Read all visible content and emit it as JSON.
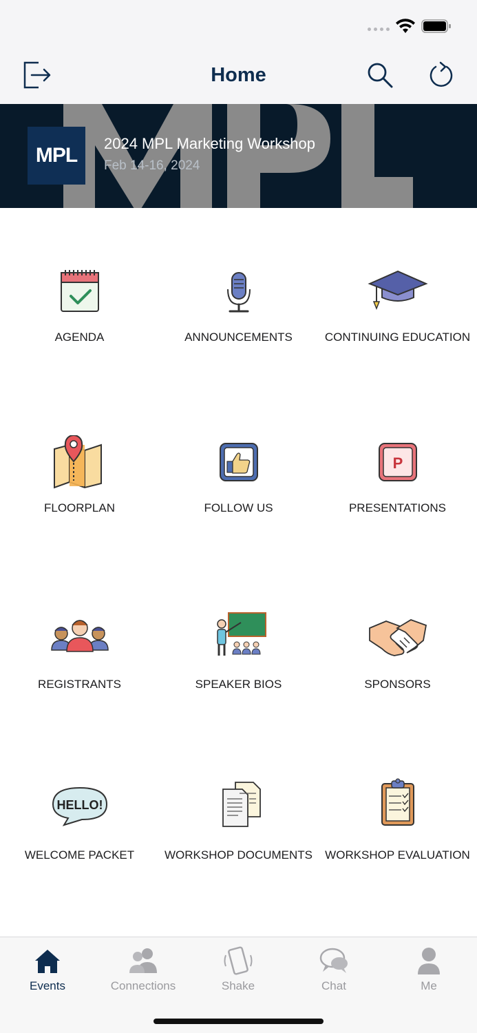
{
  "nav": {
    "title": "Home"
  },
  "banner": {
    "logo_text": "MPL",
    "bg_text": "MPL",
    "title": "2024 MPL Marketing Workshop",
    "date": "Feb 14-16, 2024"
  },
  "tiles": [
    {
      "label": "AGENDA",
      "icon": "calendar-check-icon"
    },
    {
      "label": "ANNOUNCEMENTS",
      "icon": "microphone-icon"
    },
    {
      "label": "CONTINUING EDUCATION",
      "icon": "graduation-cap-icon"
    },
    {
      "label": "FLOORPLAN",
      "icon": "map-pin-icon"
    },
    {
      "label": "FOLLOW US",
      "icon": "thumbs-up-icon"
    },
    {
      "label": "PRESENTATIONS",
      "icon": "presentation-p-icon"
    },
    {
      "label": "REGISTRANTS",
      "icon": "people-group-icon"
    },
    {
      "label": "SPEAKER BIOS",
      "icon": "teacher-board-icon"
    },
    {
      "label": "SPONSORS",
      "icon": "handshake-icon"
    },
    {
      "label": "WELCOME PACKET",
      "icon": "hello-bubble-icon"
    },
    {
      "label": "WORKSHOP DOCUMENTS",
      "icon": "documents-icon"
    },
    {
      "label": "WORKSHOP EVALUATION",
      "icon": "clipboard-icon"
    }
  ],
  "hello_text": "HELLO!",
  "presentation_letter": "P",
  "tabs": [
    {
      "label": "Events",
      "icon": "home-icon",
      "active": true
    },
    {
      "label": "Connections",
      "icon": "people-icon",
      "active": false
    },
    {
      "label": "Shake",
      "icon": "phone-shake-icon",
      "active": false
    },
    {
      "label": "Chat",
      "icon": "chat-bubbles-icon",
      "active": false
    },
    {
      "label": "Me",
      "icon": "person-icon",
      "active": false
    }
  ],
  "colors": {
    "brand_navy": "#0e2d4f",
    "banner_bg": "#081a2a",
    "tab_inactive": "#9a9a9e"
  }
}
